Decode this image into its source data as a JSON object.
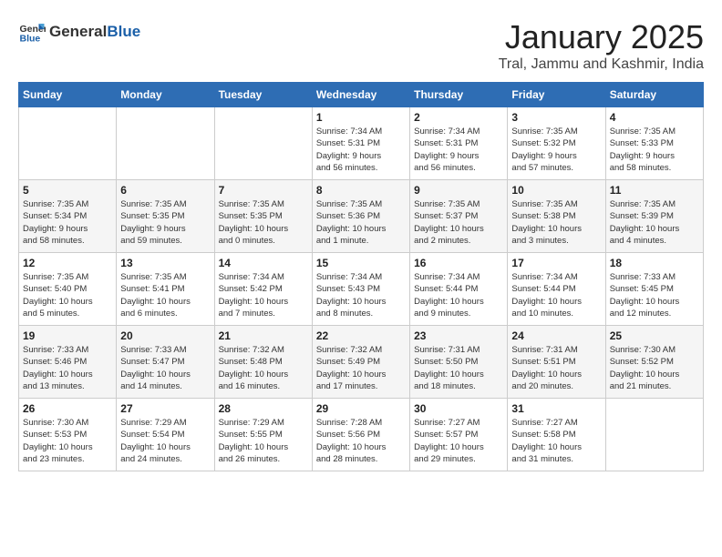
{
  "header": {
    "logo_general": "General",
    "logo_blue": "Blue",
    "month_title": "January 2025",
    "location": "Tral, Jammu and Kashmir, India"
  },
  "weekdays": [
    "Sunday",
    "Monday",
    "Tuesday",
    "Wednesday",
    "Thursday",
    "Friday",
    "Saturday"
  ],
  "weeks": [
    [
      {
        "day": "",
        "info": ""
      },
      {
        "day": "",
        "info": ""
      },
      {
        "day": "",
        "info": ""
      },
      {
        "day": "1",
        "info": "Sunrise: 7:34 AM\nSunset: 5:31 PM\nDaylight: 9 hours\nand 56 minutes."
      },
      {
        "day": "2",
        "info": "Sunrise: 7:34 AM\nSunset: 5:31 PM\nDaylight: 9 hours\nand 56 minutes."
      },
      {
        "day": "3",
        "info": "Sunrise: 7:35 AM\nSunset: 5:32 PM\nDaylight: 9 hours\nand 57 minutes."
      },
      {
        "day": "4",
        "info": "Sunrise: 7:35 AM\nSunset: 5:33 PM\nDaylight: 9 hours\nand 58 minutes."
      }
    ],
    [
      {
        "day": "5",
        "info": "Sunrise: 7:35 AM\nSunset: 5:34 PM\nDaylight: 9 hours\nand 58 minutes."
      },
      {
        "day": "6",
        "info": "Sunrise: 7:35 AM\nSunset: 5:35 PM\nDaylight: 9 hours\nand 59 minutes."
      },
      {
        "day": "7",
        "info": "Sunrise: 7:35 AM\nSunset: 5:35 PM\nDaylight: 10 hours\nand 0 minutes."
      },
      {
        "day": "8",
        "info": "Sunrise: 7:35 AM\nSunset: 5:36 PM\nDaylight: 10 hours\nand 1 minute."
      },
      {
        "day": "9",
        "info": "Sunrise: 7:35 AM\nSunset: 5:37 PM\nDaylight: 10 hours\nand 2 minutes."
      },
      {
        "day": "10",
        "info": "Sunrise: 7:35 AM\nSunset: 5:38 PM\nDaylight: 10 hours\nand 3 minutes."
      },
      {
        "day": "11",
        "info": "Sunrise: 7:35 AM\nSunset: 5:39 PM\nDaylight: 10 hours\nand 4 minutes."
      }
    ],
    [
      {
        "day": "12",
        "info": "Sunrise: 7:35 AM\nSunset: 5:40 PM\nDaylight: 10 hours\nand 5 minutes."
      },
      {
        "day": "13",
        "info": "Sunrise: 7:35 AM\nSunset: 5:41 PM\nDaylight: 10 hours\nand 6 minutes."
      },
      {
        "day": "14",
        "info": "Sunrise: 7:34 AM\nSunset: 5:42 PM\nDaylight: 10 hours\nand 7 minutes."
      },
      {
        "day": "15",
        "info": "Sunrise: 7:34 AM\nSunset: 5:43 PM\nDaylight: 10 hours\nand 8 minutes."
      },
      {
        "day": "16",
        "info": "Sunrise: 7:34 AM\nSunset: 5:44 PM\nDaylight: 10 hours\nand 9 minutes."
      },
      {
        "day": "17",
        "info": "Sunrise: 7:34 AM\nSunset: 5:44 PM\nDaylight: 10 hours\nand 10 minutes."
      },
      {
        "day": "18",
        "info": "Sunrise: 7:33 AM\nSunset: 5:45 PM\nDaylight: 10 hours\nand 12 minutes."
      }
    ],
    [
      {
        "day": "19",
        "info": "Sunrise: 7:33 AM\nSunset: 5:46 PM\nDaylight: 10 hours\nand 13 minutes."
      },
      {
        "day": "20",
        "info": "Sunrise: 7:33 AM\nSunset: 5:47 PM\nDaylight: 10 hours\nand 14 minutes."
      },
      {
        "day": "21",
        "info": "Sunrise: 7:32 AM\nSunset: 5:48 PM\nDaylight: 10 hours\nand 16 minutes."
      },
      {
        "day": "22",
        "info": "Sunrise: 7:32 AM\nSunset: 5:49 PM\nDaylight: 10 hours\nand 17 minutes."
      },
      {
        "day": "23",
        "info": "Sunrise: 7:31 AM\nSunset: 5:50 PM\nDaylight: 10 hours\nand 18 minutes."
      },
      {
        "day": "24",
        "info": "Sunrise: 7:31 AM\nSunset: 5:51 PM\nDaylight: 10 hours\nand 20 minutes."
      },
      {
        "day": "25",
        "info": "Sunrise: 7:30 AM\nSunset: 5:52 PM\nDaylight: 10 hours\nand 21 minutes."
      }
    ],
    [
      {
        "day": "26",
        "info": "Sunrise: 7:30 AM\nSunset: 5:53 PM\nDaylight: 10 hours\nand 23 minutes."
      },
      {
        "day": "27",
        "info": "Sunrise: 7:29 AM\nSunset: 5:54 PM\nDaylight: 10 hours\nand 24 minutes."
      },
      {
        "day": "28",
        "info": "Sunrise: 7:29 AM\nSunset: 5:55 PM\nDaylight: 10 hours\nand 26 minutes."
      },
      {
        "day": "29",
        "info": "Sunrise: 7:28 AM\nSunset: 5:56 PM\nDaylight: 10 hours\nand 28 minutes."
      },
      {
        "day": "30",
        "info": "Sunrise: 7:27 AM\nSunset: 5:57 PM\nDaylight: 10 hours\nand 29 minutes."
      },
      {
        "day": "31",
        "info": "Sunrise: 7:27 AM\nSunset: 5:58 PM\nDaylight: 10 hours\nand 31 minutes."
      },
      {
        "day": "",
        "info": ""
      }
    ]
  ]
}
